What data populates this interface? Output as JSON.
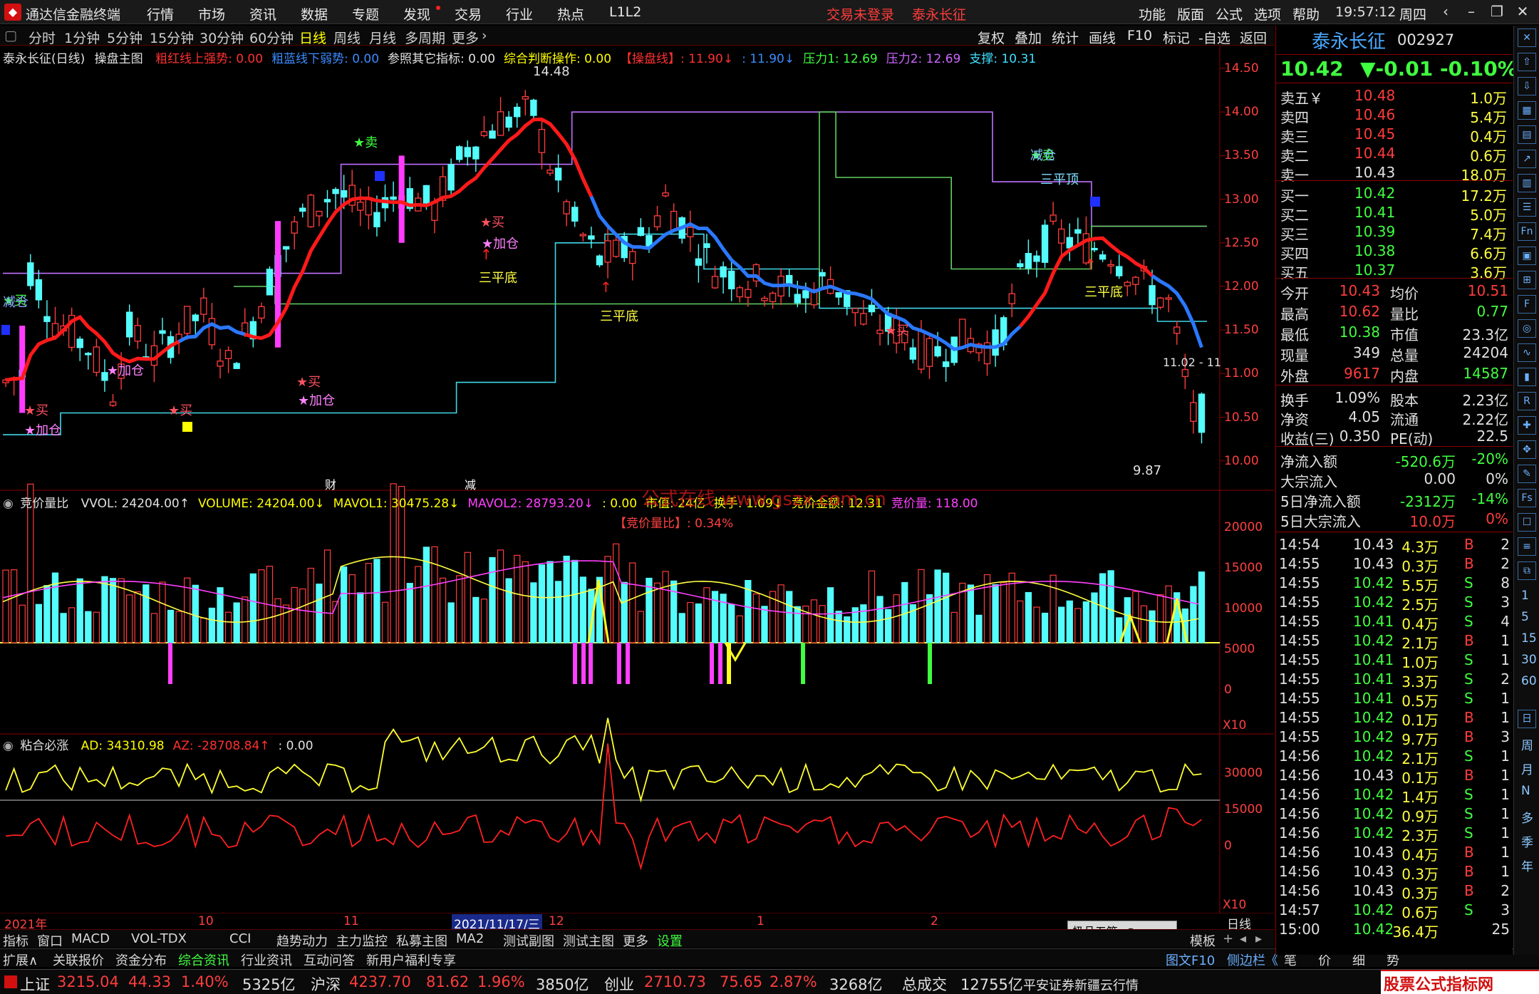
{
  "titlebar": {
    "app_name": "通达信金融终端",
    "menus": [
      "行情",
      "市场",
      "资讯",
      "数据",
      "专题",
      "发现",
      "交易",
      "行业",
      "热点",
      "L1L2"
    ],
    "login_status": "交易未登录",
    "stock_name": "泰永长征",
    "right_menus": [
      "功能",
      "版面",
      "公式",
      "选项",
      "帮助"
    ],
    "time": "19:57:12",
    "weekday": "周四"
  },
  "periods": [
    "分时",
    "1分钟",
    "5分钟",
    "15分钟",
    "30分钟",
    "60分钟",
    "日线",
    "周线",
    "月线",
    "多周期",
    "更多"
  ],
  "active_period": "日线",
  "toolbar_right": [
    "复权",
    "叠加",
    "统计",
    "画线",
    "F10",
    "标记",
    "-自选",
    "返回"
  ],
  "main_panel": {
    "title": "泰永长征(日线)",
    "indicator": "操盘主图",
    "legend": [
      {
        "text": "粗红线上强势: 0.00",
        "color": "#ff3030"
      },
      {
        "text": "粗蓝线下弱势: 0.00",
        "color": "#3a8cff"
      },
      {
        "text": "参照其它指标: 0.00",
        "color": "#e0e0e0"
      },
      {
        "text": "综合判断操作: 0.00",
        "color": "#ffff00"
      },
      {
        "text": "【操盘线】: 11.90↓",
        "color": "#ff3030"
      },
      {
        "text": ": 11.90↓",
        "color": "#3a8cff"
      },
      {
        "text": "压力1: 12.69",
        "color": "#40ff40"
      },
      {
        "text": "压力2: 12.69",
        "color": "#cc66ff"
      },
      {
        "text": "支撑: 10.31",
        "color": "#40e0ff"
      }
    ],
    "y_ticks": [
      "14.50",
      "14.00",
      "13.50",
      "13.00",
      "12.50",
      "12.00",
      "11.50",
      "11.00",
      "10.50",
      "10.00"
    ],
    "annotations": {
      "high": "14.48",
      "low": "9.87",
      "last": "11.02 - 11",
      "buy": "买",
      "sell": "卖",
      "add": "加仓",
      "reduce": "减仓",
      "bottom3": "三平底",
      "top3": "三平顶",
      "cai": "财",
      "jian": "减"
    }
  },
  "vol_panel": {
    "title": "竞价量比",
    "legend": [
      {
        "text": "VVOL: 24204.00↑",
        "color": "#e0e0e0"
      },
      {
        "text": "VOLUME: 24204.00↓",
        "color": "#ffff00"
      },
      {
        "text": "MAVOL1: 30475.28↓",
        "color": "#ffff00"
      },
      {
        "text": "MAVOL2: 28793.20↓",
        "color": "#ff40ff"
      },
      {
        "text": ": 0.00",
        "color": "#ffff00"
      },
      {
        "text": "市值: 24亿",
        "color": "#ffff00"
      },
      {
        "text": "换手: 1.09↓",
        "color": "#ffff00"
      },
      {
        "text": "竞价金额: 12.31",
        "color": "#ffff00"
      },
      {
        "text": "竞价量: 118.00",
        "color": "#ff40ff"
      }
    ],
    "sub_legend": "【竞价量比】: 0.34%",
    "watermark": "公式在线 www.gszx.com.cn",
    "y_ticks": [
      "20000",
      "15000",
      "10000",
      "5000",
      "0"
    ],
    "x10": "X10"
  },
  "ad_panel": {
    "title": "粘合必涨",
    "legend": [
      {
        "text": "AD: 34310.98",
        "color": "#ffff00"
      },
      {
        "text": "AZ: -28708.84↑",
        "color": "#ff3030"
      },
      {
        "text": ": 0.00",
        "color": "#e0e0e0"
      }
    ],
    "y_ticks": [
      "30000",
      "15000",
      "0"
    ],
    "x10": "X10"
  },
  "date_axis": {
    "labels": [
      "2021年",
      "10",
      "11",
      "2021/11/17/三",
      "12",
      "1",
      "2"
    ],
    "right_label": "日线"
  },
  "tabs_row1": [
    "指标",
    "窗口",
    "MACD",
    "VOL-TDX",
    "CCI",
    "趋势动力",
    "主力监控",
    "私募主图",
    "MA2",
    "测试副图",
    "测试主图",
    "更多",
    "设置"
  ],
  "tabs_row1_right": [
    "模板"
  ],
  "tabs_row2": [
    "扩展∧",
    "关联报价",
    "资金分布",
    "综合资讯",
    "行业资讯",
    "互动问答",
    "新用户福利专享"
  ],
  "tabs_row2_right": [
    "图文F10",
    "侧边栏《",
    "笔",
    "价",
    "细",
    "势"
  ],
  "overlay_box": "极品五笔",
  "quote": {
    "name": "泰永长征",
    "code": "002927",
    "price": "10.42",
    "change": "▼-0.01",
    "pct": "-0.10%",
    "asks": [
      {
        "label": "卖五￥",
        "price": "10.48",
        "vol": "1.0万"
      },
      {
        "label": "卖四",
        "price": "10.46",
        "vol": "5.4万"
      },
      {
        "label": "卖三",
        "price": "10.45",
        "vol": "0.4万"
      },
      {
        "label": "卖二",
        "price": "10.44",
        "vol": "0.6万"
      },
      {
        "label": "卖一",
        "price": "10.43",
        "vol": "18.0万"
      }
    ],
    "bids": [
      {
        "label": "买一",
        "price": "10.42",
        "vol": "17.2万"
      },
      {
        "label": "买二",
        "price": "10.41",
        "vol": "5.0万"
      },
      {
        "label": "买三",
        "price": "10.39",
        "vol": "7.4万"
      },
      {
        "label": "买四",
        "price": "10.38",
        "vol": "6.6万"
      },
      {
        "label": "买五",
        "price": "10.37",
        "vol": "3.6万"
      }
    ],
    "stats": [
      {
        "l1": "今开",
        "v1": "10.43",
        "l2": "均价",
        "v2": "10.51",
        "c1": "#ff3c3c",
        "c2": "#ff3c3c"
      },
      {
        "l1": "最高",
        "v1": "10.62",
        "l2": "量比",
        "v2": "0.77",
        "c1": "#ff3c3c",
        "c2": "#40ff40"
      },
      {
        "l1": "最低",
        "v1": "10.38",
        "l2": "市值",
        "v2": "23.3亿",
        "c1": "#40ff40",
        "c2": "#e0e0e0"
      },
      {
        "l1": "现量",
        "v1": "349",
        "l2": "总量",
        "v2": "24204",
        "c1": "#e0e0e0",
        "c2": "#e0e0e0"
      },
      {
        "l1": "外盘",
        "v1": "9617",
        "l2": "内盘",
        "v2": "14587",
        "c1": "#ff3c3c",
        "c2": "#40ff40"
      }
    ],
    "stats2": [
      {
        "l1": "换手",
        "v1": "1.09%",
        "l2": "股本",
        "v2": "2.23亿"
      },
      {
        "l1": "净资",
        "v1": "4.05",
        "l2": "流通",
        "v2": "2.22亿"
      },
      {
        "l1": "收益(三)",
        "v1": "0.350",
        "l2": "PE(动)",
        "v2": "22.5"
      }
    ],
    "flows": [
      {
        "label": "净流入额",
        "value": "-520.6万",
        "pct": "-20%",
        "color": "#40ff40"
      },
      {
        "label": "大宗流入",
        "value": "0.00",
        "pct": "0%",
        "color": "#e0e0e0"
      },
      {
        "label": "5日净流入额",
        "value": "-2312万",
        "pct": "-14%",
        "color": "#40ff40"
      },
      {
        "label": "5日大宗流入",
        "value": "10.0万",
        "pct": "0%",
        "color": "#ff3c3c"
      }
    ],
    "ticks": [
      {
        "t": "14:54",
        "p": "10.43",
        "v": "4.3万",
        "s": "B",
        "n": "2"
      },
      {
        "t": "14:55",
        "p": "10.43",
        "v": "0.3万",
        "s": "B",
        "n": "2"
      },
      {
        "t": "14:55",
        "p": "10.42",
        "v": "5.5万",
        "s": "S",
        "n": "8"
      },
      {
        "t": "14:55",
        "p": "10.42",
        "v": "2.5万",
        "s": "S",
        "n": "3"
      },
      {
        "t": "14:55",
        "p": "10.41",
        "v": "0.4万",
        "s": "S",
        "n": "4"
      },
      {
        "t": "14:55",
        "p": "10.42",
        "v": "2.1万",
        "s": "B",
        "n": "1"
      },
      {
        "t": "14:55",
        "p": "10.41",
        "v": "1.0万",
        "s": "S",
        "n": "1"
      },
      {
        "t": "14:55",
        "p": "10.41",
        "v": "3.3万",
        "s": "S",
        "n": "2"
      },
      {
        "t": "14:55",
        "p": "10.41",
        "v": "0.5万",
        "s": "S",
        "n": "1"
      },
      {
        "t": "14:55",
        "p": "10.42",
        "v": "0.1万",
        "s": "B",
        "n": "1"
      },
      {
        "t": "14:55",
        "p": "10.42",
        "v": "9.7万",
        "s": "B",
        "n": "3"
      },
      {
        "t": "14:56",
        "p": "10.42",
        "v": "2.1万",
        "s": "S",
        "n": "1"
      },
      {
        "t": "14:56",
        "p": "10.43",
        "v": "0.1万",
        "s": "B",
        "n": "1"
      },
      {
        "t": "14:56",
        "p": "10.42",
        "v": "1.4万",
        "s": "S",
        "n": "1"
      },
      {
        "t": "14:56",
        "p": "10.42",
        "v": "0.9万",
        "s": "S",
        "n": "1"
      },
      {
        "t": "14:56",
        "p": "10.42",
        "v": "2.3万",
        "s": "S",
        "n": "1"
      },
      {
        "t": "14:56",
        "p": "10.43",
        "v": "0.4万",
        "s": "B",
        "n": "1"
      },
      {
        "t": "14:56",
        "p": "10.43",
        "v": "0.3万",
        "s": "B",
        "n": "1"
      },
      {
        "t": "14:56",
        "p": "10.43",
        "v": "0.3万",
        "s": "B",
        "n": "2"
      },
      {
        "t": "14:57",
        "p": "10.42",
        "v": "0.6万",
        "s": "S",
        "n": "3"
      },
      {
        "t": "15:00",
        "p": "10.42",
        "v": "36.4万",
        "s": "",
        "n": "25"
      }
    ],
    "prev_close": "10.43"
  },
  "right_tools_text": [
    "日",
    "周",
    "月",
    "N",
    "多",
    "季",
    "年"
  ],
  "status": {
    "sh_label": "上证",
    "sh_value": "3215.04",
    "sh_change": "44.33",
    "sh_pct": "1.40%",
    "sh_amount": "5325亿",
    "hs_label": "沪深",
    "hs_value": "4237.70",
    "hs_change": "81.62",
    "hs_pct": "1.96%",
    "hs_amount": "3850亿",
    "cy_label": "创业",
    "cy_value": "2710.73",
    "cy_change": "75.65",
    "cy_pct": "2.87%",
    "cy_amount": "3268亿",
    "total_label": "总成交",
    "total_value": "12755亿",
    "broker": "平安证券新疆云行情"
  },
  "branding": {
    "logo": "股票公式指标网",
    "url": "www.gszx.com.cn"
  },
  "colors": {
    "up": "#ff3c3c",
    "down": "#40ff40",
    "bull_candle": "#ff3c3c",
    "bear_candle": "#54fcfc",
    "axis": "#8a0000"
  }
}
